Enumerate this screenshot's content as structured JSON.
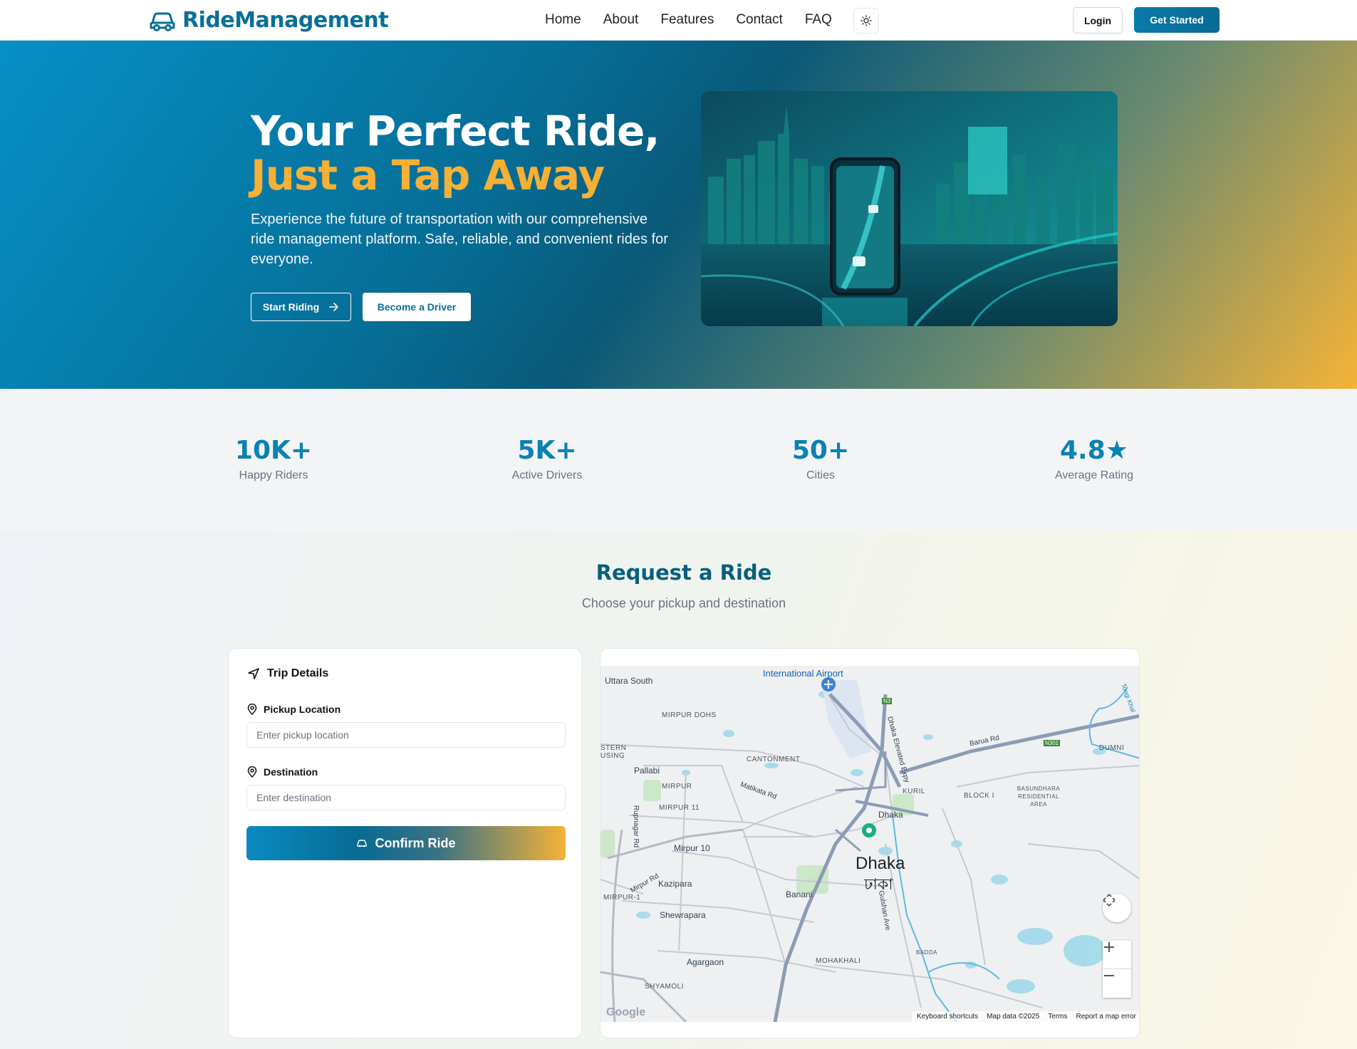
{
  "nav": {
    "brand": "RideManagement",
    "links": [
      "Home",
      "About",
      "Features",
      "Contact",
      "FAQ"
    ],
    "login": "Login",
    "get_started": "Get Started"
  },
  "hero": {
    "title_line1": "Your Perfect Ride,",
    "title_line2": "Just a Tap Away",
    "subtitle": "Experience the future of transportation with our comprehensive ride management platform. Safe, reliable, and convenient rides for everyone.",
    "start_riding": "Start Riding",
    "become_driver": "Become a Driver"
  },
  "stats": [
    {
      "value": "10K+",
      "label": "Happy Riders"
    },
    {
      "value": "5K+",
      "label": "Active Drivers"
    },
    {
      "value": "50+",
      "label": "Cities"
    },
    {
      "value": "4.8★",
      "label": "Average Rating"
    }
  ],
  "request": {
    "title": "Request a Ride",
    "subtitle": "Choose your pickup and destination",
    "trip_details": "Trip Details",
    "pickup_label": "Pickup Location",
    "pickup_placeholder": "Enter pickup location",
    "destination_label": "Destination",
    "destination_placeholder": "Enter destination",
    "confirm": "Confirm Ride"
  },
  "map": {
    "labels": {
      "airport": "International Airport",
      "uttara": "Uttara South",
      "mirpur_dohs": "MIRPUR DOHS",
      "eastern_housing": "STERN USING",
      "cantonment": "CANTONMENT",
      "pallabi": "Pallabi",
      "mirpur": "MIRPUR",
      "mirpur11": "MIRPUR 11",
      "matikata": "Matikata Rd",
      "kuril": "KURIL",
      "block_i": "BLOCK I",
      "basundhara": "BASUNDHARA RESIDENTIAL AREA",
      "barua": "Barua Rd",
      "dumni": "DUMNI",
      "dhaka_small": "Dhaka",
      "dhaka": "Dhaka",
      "dhaka_bn": "ঢাকা",
      "mirpur10": "Mirpur 10",
      "kazipara": "Kazipara",
      "mirpur1": "MIRPUR-1",
      "banani": "Banani",
      "shewrapara": "Shewrapara",
      "agargaon": "Agargaon",
      "mohakhali": "MOHAKHALI",
      "badda": "BADDA",
      "shyamoli": "SHYAMOLI",
      "gulshan": "Gulshan Ave",
      "elevated": "Dhaka Elevated Expy",
      "rupnagar": "Rupnagar Rd",
      "mirpur_rd": "Mirpur Rd",
      "n3": "N3",
      "n301": "N301",
      "tongi": "Tongi Khal"
    },
    "footer": [
      "Keyboard shortcuts",
      "Map data ©2025",
      "Terms",
      "Report a map error"
    ],
    "google": "Google"
  }
}
